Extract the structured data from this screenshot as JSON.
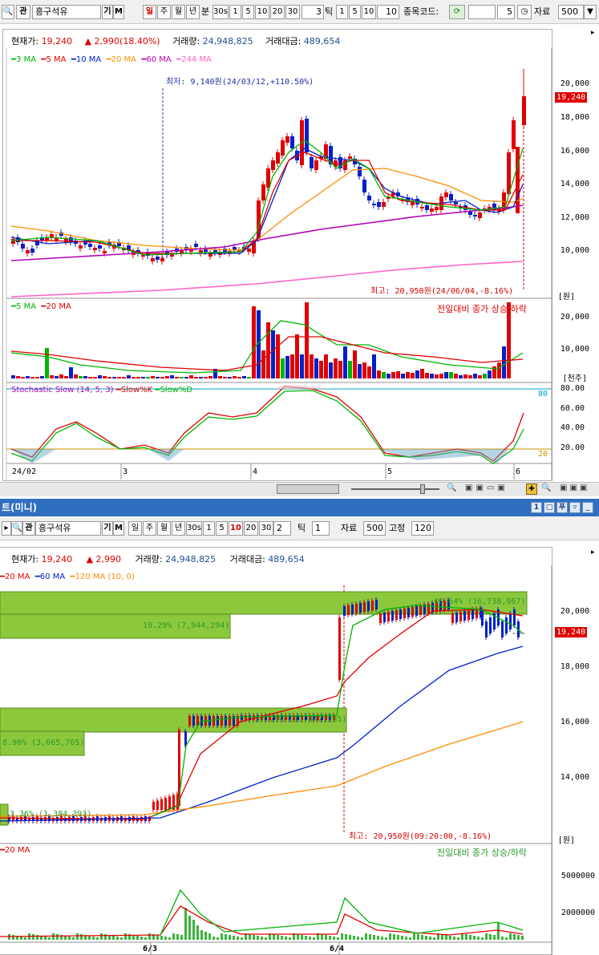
{
  "top": {
    "toolbar": {
      "search_icon": "search-icon",
      "gwan_label": "관",
      "stock_name": "흥구석유",
      "gi_label": "기",
      "m_label": "M",
      "periods": [
        "일",
        "주",
        "월",
        "년",
        "분",
        "30s",
        "1",
        "5",
        "10",
        "20",
        "30"
      ],
      "tick_value": "3",
      "tick_label": "틱",
      "tick_periods": [
        "1",
        "5",
        "10",
        "10"
      ],
      "code_label": "종목코드:",
      "count_value": "5",
      "data_label": "자료",
      "data_value": "500"
    },
    "info": {
      "price_label": "현재가:",
      "price": "19,240",
      "change_arrow": "▲",
      "change": "2,990(18.40%)",
      "volume_label": "거래량:",
      "volume": "24,948,825",
      "amount_label": "거래대금:",
      "amount": "489,654"
    },
    "ma_legend": [
      {
        "label": "3 MA",
        "color": "#00b400"
      },
      {
        "label": "5 MA",
        "color": "#e00000"
      },
      {
        "label": "10 MA",
        "color": "#0020c8"
      },
      {
        "label": "20 MA",
        "color": "#ff8c00"
      },
      {
        "label": "60 MA",
        "color": "#b400b4"
      },
      {
        "label": "244 MA",
        "color": "#ff64c8"
      }
    ],
    "low_annotation": "최저: 9,140원(24/03/12,+110.50%)",
    "high_annotation": "최고: 20,950원(24/06/04,-8.16%)",
    "price_axis": [
      "20,000",
      "18,000",
      "16,000",
      "14,000",
      "12,000",
      "10,000"
    ],
    "price_unit": "[원]",
    "current_price_tag": "19,240",
    "volume_legend": [
      {
        "label": "5 MA",
        "color": "#00b400"
      },
      {
        "label": "20 MA",
        "color": "#e00000"
      }
    ],
    "volume_note": "전일대비 종가 상승/하락",
    "volume_axis": [
      "20,000",
      "10,000"
    ],
    "volume_unit": "[천주]",
    "stoch_title": "Stochastic Slow (14, 5, 3)",
    "stoch_k": "Slow%K",
    "stoch_d": "Slow%D",
    "stoch_axis": [
      "80.00",
      "60.00",
      "40.00",
      "20.00"
    ],
    "stoch_level_80": "80",
    "stoch_level_20": "20",
    "date_labels": [
      "24/02",
      "3",
      "4",
      "5",
      "6"
    ]
  },
  "mini": {
    "title": "트(미니)",
    "toolbar": {
      "gwan_label": "관",
      "stock_name": "흥구석유",
      "gi_label": "기",
      "m_label": "M",
      "periods": [
        "일",
        "주",
        "월",
        "년",
        "30s",
        "1",
        "5",
        "10",
        "20",
        "30"
      ],
      "custom_value": "2",
      "tick_label": "틱",
      "tick_value": "1",
      "data_label": "자료",
      "data_value": "500",
      "fixed_label": "고정",
      "fixed_value": "120"
    },
    "info": {
      "price_label": "현재가:",
      "price": "19,240",
      "change_arrow": "▲",
      "change": "2,990",
      "volume_label": "거래량:",
      "volume": "24,948,825",
      "amount_label": "거래대금:",
      "amount": "489,654"
    },
    "ma_legend": [
      {
        "label": "20 MA",
        "color": "#e00000"
      },
      {
        "label": "60 MA",
        "color": "#0020c8"
      },
      {
        "label": "120 MA (10, 0)",
        "color": "#ff8c00"
      }
    ],
    "profile_bars": [
      {
        "label": "40.64% (16,738,967)"
      },
      {
        "label": "19.29% (7,944,294)"
      },
      {
        "label": "27.79% (11,447,565)"
      },
      {
        "label": "8.90% (3,665,765)"
      },
      {
        "label": "3.36% (1,384,393)"
      }
    ],
    "high_annotation": "최고: 20,950원(09:20:00,-8.16%)",
    "price_axis": [
      "20,000",
      "18,000",
      "16,000",
      "14,000"
    ],
    "price_unit": "[원]",
    "current_price_tag": "19,240",
    "volume_legend": [
      {
        "label": "20 MA",
        "color": "#e00000"
      }
    ],
    "volume_note": "전일대비 종가 상승/하락",
    "volume_axis": [
      "5000000",
      "2000000"
    ],
    "date_labels": [
      "6/3",
      "6/4"
    ]
  }
}
